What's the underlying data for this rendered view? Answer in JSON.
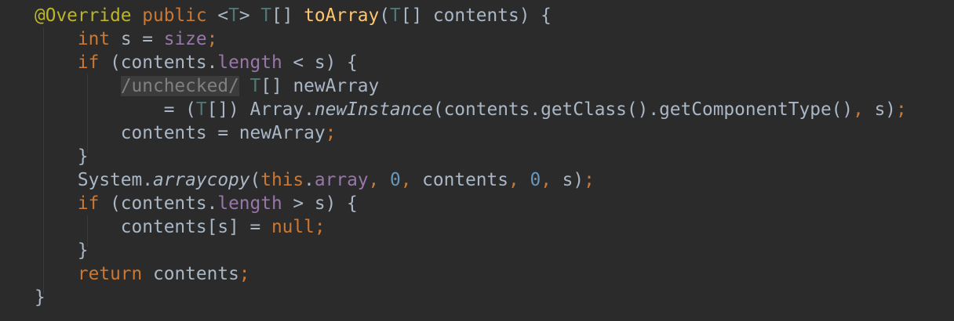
{
  "colors": {
    "background": "#2b2b2b",
    "annotation": "#bbb529",
    "keyword": "#cc7832",
    "type_param": "#507874",
    "method_decl": "#ffc66d",
    "field": "#9876aa",
    "number": "#6897bb",
    "default": "#a9b7c6",
    "comment": "#808080",
    "comment_bg": "#3c3c3c"
  },
  "code_lines": [
    [
      {
        "t": "@Override",
        "c": "annotation"
      },
      {
        "t": " "
      },
      {
        "t": "public",
        "c": "keyword"
      },
      {
        "t": " <"
      },
      {
        "t": "T",
        "c": "type_param"
      },
      {
        "t": "> "
      },
      {
        "t": "T",
        "c": "type_param"
      },
      {
        "t": "[] "
      },
      {
        "t": "toArray",
        "c": "method_decl"
      },
      {
        "t": "("
      },
      {
        "t": "T",
        "c": "type_param"
      },
      {
        "t": "[] contents) {"
      }
    ],
    [
      {
        "t": "    "
      },
      {
        "t": "int",
        "c": "keyword"
      },
      {
        "t": " s = "
      },
      {
        "t": "size",
        "c": "field"
      },
      {
        "t": ";",
        "c": "keyword"
      }
    ],
    [
      {
        "t": "    "
      },
      {
        "t": "if",
        "c": "keyword"
      },
      {
        "t": " (contents."
      },
      {
        "t": "length",
        "c": "field"
      },
      {
        "t": " < s) {"
      }
    ],
    [
      {
        "t": "        "
      },
      {
        "t": "/unchecked/",
        "c": "comment"
      },
      {
        "t": " "
      },
      {
        "t": "T",
        "c": "type_param"
      },
      {
        "t": "[] newArray"
      }
    ],
    [
      {
        "t": "            = ("
      },
      {
        "t": "T",
        "c": "type_param"
      },
      {
        "t": "[]) Array."
      },
      {
        "t": "newInstance",
        "c": "italic"
      },
      {
        "t": "(contents.getClass().getComponentType()"
      },
      {
        "t": ",",
        "c": "keyword"
      },
      {
        "t": " s)"
      },
      {
        "t": ";",
        "c": "keyword"
      }
    ],
    [
      {
        "t": "        contents = newArray"
      },
      {
        "t": ";",
        "c": "keyword"
      }
    ],
    [
      {
        "t": "    }"
      }
    ],
    [
      {
        "t": "    System."
      },
      {
        "t": "arraycopy",
        "c": "italic"
      },
      {
        "t": "("
      },
      {
        "t": "this",
        "c": "keyword"
      },
      {
        "t": "."
      },
      {
        "t": "array",
        "c": "field"
      },
      {
        "t": ",",
        "c": "keyword"
      },
      {
        "t": " "
      },
      {
        "t": "0",
        "c": "number"
      },
      {
        "t": ",",
        "c": "keyword"
      },
      {
        "t": " contents"
      },
      {
        "t": ",",
        "c": "keyword"
      },
      {
        "t": " "
      },
      {
        "t": "0",
        "c": "number"
      },
      {
        "t": ",",
        "c": "keyword"
      },
      {
        "t": " s)"
      },
      {
        "t": ";",
        "c": "keyword"
      }
    ],
    [
      {
        "t": "    "
      },
      {
        "t": "if",
        "c": "keyword"
      },
      {
        "t": " (contents."
      },
      {
        "t": "length",
        "c": "field"
      },
      {
        "t": " > s) {"
      }
    ],
    [
      {
        "t": "        contents[s] = "
      },
      {
        "t": "null",
        "c": "keyword"
      },
      {
        "t": ";",
        "c": "keyword"
      }
    ],
    [
      {
        "t": "    }"
      }
    ],
    [
      {
        "t": "    "
      },
      {
        "t": "return",
        "c": "keyword"
      },
      {
        "t": " contents"
      },
      {
        "t": ";",
        "c": "keyword"
      }
    ],
    [
      {
        "t": "}"
      }
    ]
  ]
}
